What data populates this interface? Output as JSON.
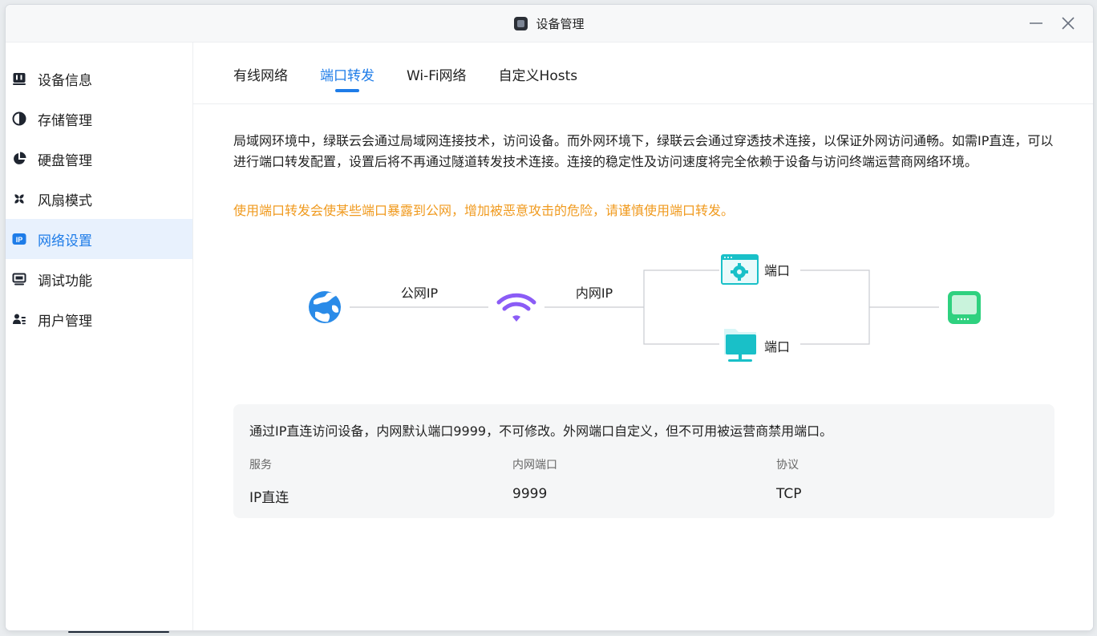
{
  "window": {
    "title": "设备管理"
  },
  "sidebar": {
    "items": [
      {
        "label": "设备信息",
        "icon": "device-info-icon"
      },
      {
        "label": "存储管理",
        "icon": "storage-pie-icon"
      },
      {
        "label": "硬盘管理",
        "icon": "disk-pie-icon"
      },
      {
        "label": "风扇模式",
        "icon": "fan-icon"
      },
      {
        "label": "网络设置",
        "icon": "ip-icon",
        "active": true
      },
      {
        "label": "调试功能",
        "icon": "monitor-icon"
      },
      {
        "label": "用户管理",
        "icon": "users-icon"
      }
    ]
  },
  "tabs": [
    {
      "label": "有线网络"
    },
    {
      "label": "端口转发",
      "active": true
    },
    {
      "label": "Wi-Fi网络"
    },
    {
      "label": "自定义Hosts"
    }
  ],
  "content": {
    "description": "局域网环境中，绿联云会通过局域网连接技术，访问设备。而外网环境下，绿联云会通过穿透技术连接，以保证外网访问通畅。如需IP直连，可以进行端口转发配置，设置后将不再通过隧道转发技术连接。连接的稳定性及访问速度将完全依赖于设备与访问终端运营商网络环境。",
    "warning": "使用端口转发会使某些端口暴露到公网，增加被恶意攻击的危险，请谨慎使用端口转发。"
  },
  "diagram": {
    "public_ip_label": "公网IP",
    "internal_ip_label": "内网IP",
    "port_label_top": "端口",
    "port_label_bottom": "端口"
  },
  "info": {
    "text": "通过IP直连访问设备，内网默认端口9999，不可修改。外网端口自定义，但不可用被运营商禁用端口。",
    "headers": {
      "service": "服务",
      "port": "内网端口",
      "protocol": "协议"
    },
    "row": {
      "service": "IP直连",
      "port": "9999",
      "protocol": "TCP"
    }
  },
  "colors": {
    "accent": "#1e7ce8",
    "warning": "#f09a1e",
    "wifi": "#8b5cf6",
    "teal": "#19c0c8",
    "green": "#2fd17f"
  }
}
